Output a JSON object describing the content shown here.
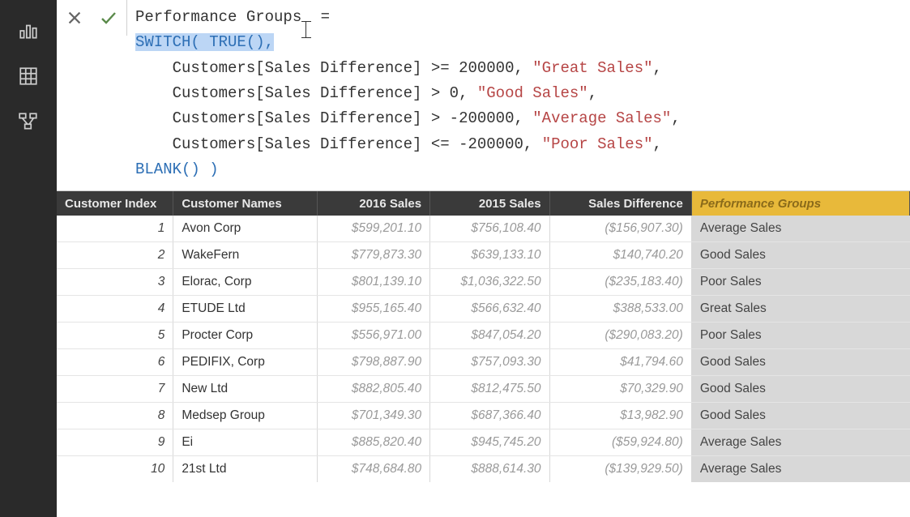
{
  "sidebar": {
    "report_icon": "report-icon",
    "data_icon": "data-icon",
    "model_icon": "model-icon"
  },
  "formula": {
    "line1_a": "Performance Groups",
    "line1_b": " =",
    "line2_hl": "SWITCH( TRUE(),",
    "line3_pre": "    Customers[Sales Difference] >= 200000, ",
    "line3_str": "\"Great Sales\"",
    "line3_post": ",",
    "line4_pre": "    Customers[Sales Difference] > 0, ",
    "line4_str": "\"Good Sales\"",
    "line4_post": ",",
    "line5_pre": "    Customers[Sales Difference] > -200000, ",
    "line5_str": "\"Average Sales\"",
    "line5_post": ",",
    "line6_pre": "    Customers[Sales Difference] <= -200000, ",
    "line6_str": "\"Poor Sales\"",
    "line6_post": ",",
    "line7": "BLANK() )"
  },
  "table": {
    "headers": {
      "idx": "Customer Index",
      "name": "Customer Names",
      "s2016": "2016 Sales",
      "s2015": "2015 Sales",
      "diff": "Sales Difference",
      "perf": "Performance Groups"
    },
    "rows": [
      {
        "idx": "1",
        "name": "Avon Corp",
        "s2016": "$599,201.10",
        "s2015": "$756,108.40",
        "diff": "($156,907.30)",
        "perf": "Average Sales"
      },
      {
        "idx": "2",
        "name": "WakeFern",
        "s2016": "$779,873.30",
        "s2015": "$639,133.10",
        "diff": "$140,740.20",
        "perf": "Good Sales"
      },
      {
        "idx": "3",
        "name": "Elorac, Corp",
        "s2016": "$801,139.10",
        "s2015": "$1,036,322.50",
        "diff": "($235,183.40)",
        "perf": "Poor Sales"
      },
      {
        "idx": "4",
        "name": "ETUDE Ltd",
        "s2016": "$955,165.40",
        "s2015": "$566,632.40",
        "diff": "$388,533.00",
        "perf": "Great Sales"
      },
      {
        "idx": "5",
        "name": "Procter Corp",
        "s2016": "$556,971.00",
        "s2015": "$847,054.20",
        "diff": "($290,083.20)",
        "perf": "Poor Sales"
      },
      {
        "idx": "6",
        "name": "PEDIFIX, Corp",
        "s2016": "$798,887.90",
        "s2015": "$757,093.30",
        "diff": "$41,794.60",
        "perf": "Good Sales"
      },
      {
        "idx": "7",
        "name": "New Ltd",
        "s2016": "$882,805.40",
        "s2015": "$812,475.50",
        "diff": "$70,329.90",
        "perf": "Good Sales"
      },
      {
        "idx": "8",
        "name": "Medsep Group",
        "s2016": "$701,349.30",
        "s2015": "$687,366.40",
        "diff": "$13,982.90",
        "perf": "Good Sales"
      },
      {
        "idx": "9",
        "name": "Ei",
        "s2016": "$885,820.40",
        "s2015": "$945,745.20",
        "diff": "($59,924.80)",
        "perf": "Average Sales"
      },
      {
        "idx": "10",
        "name": "21st Ltd",
        "s2016": "$748,684.80",
        "s2015": "$888,614.30",
        "diff": "($139,929.50)",
        "perf": "Average Sales"
      }
    ]
  }
}
